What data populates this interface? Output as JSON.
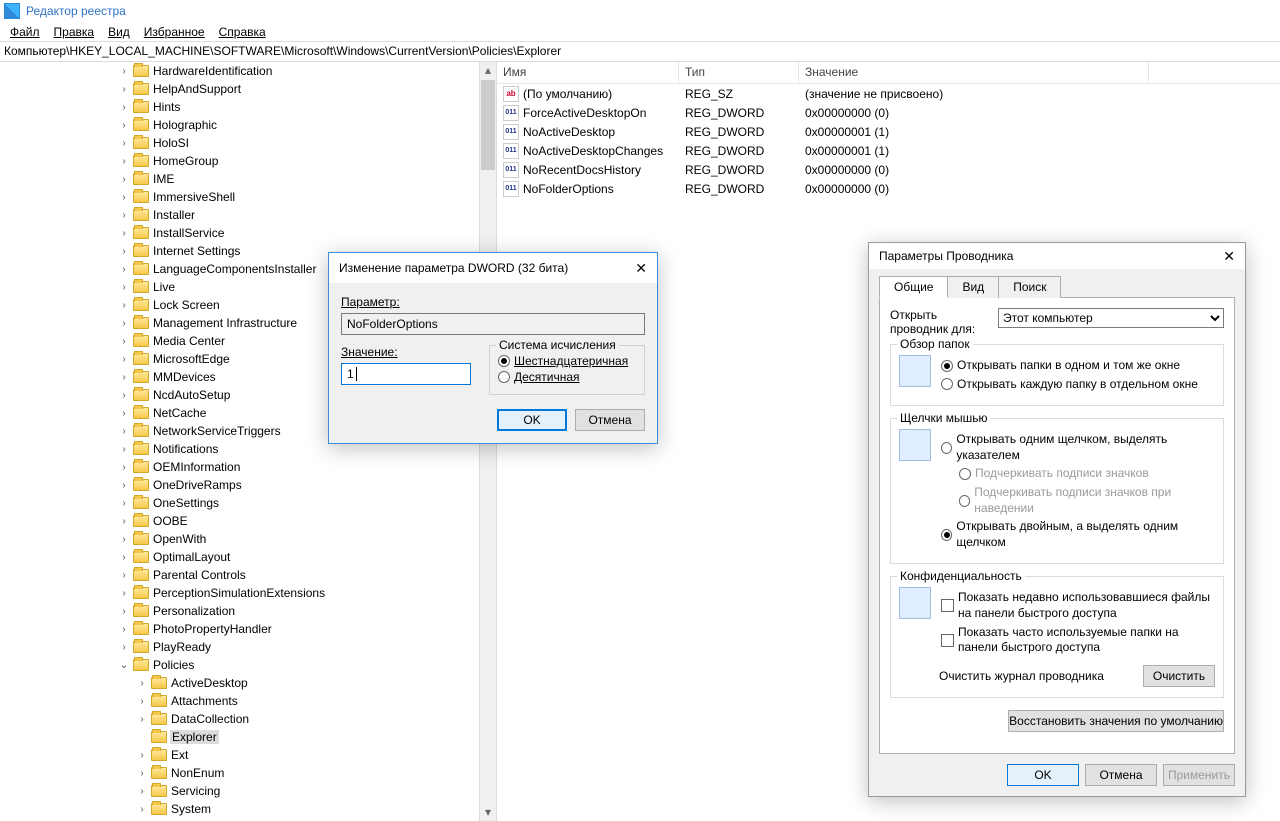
{
  "titlebar": {
    "title": "Редактор реестра"
  },
  "menu": [
    "Файл",
    "Правка",
    "Вид",
    "Избранное",
    "Справка"
  ],
  "path": "Компьютер\\HKEY_LOCAL_MACHINE\\SOFTWARE\\Microsoft\\Windows\\CurrentVersion\\Policies\\Explorer",
  "tree": {
    "items1": [
      "HardwareIdentification",
      "HelpAndSupport",
      "Hints",
      "Holographic",
      "HoloSI",
      "HomeGroup",
      "IME",
      "ImmersiveShell",
      "Installer",
      "InstallService",
      "Internet Settings",
      "LanguageComponentsInstaller",
      "Live",
      "Lock Screen",
      "Management Infrastructure",
      "Media Center",
      "MicrosoftEdge",
      "MMDevices",
      "NcdAutoSetup",
      "NetCache",
      "NetworkServiceTriggers",
      "Notifications",
      "OEMInformation",
      "OneDriveRamps",
      "OneSettings",
      "OOBE",
      "OpenWith",
      "OptimalLayout",
      "Parental Controls",
      "PerceptionSimulationExtensions",
      "Personalization",
      "PhotoPropertyHandler",
      "PlayReady"
    ],
    "policies": "Policies",
    "items2": [
      "ActiveDesktop",
      "Attachments",
      "DataCollection"
    ],
    "selected": "Explorer",
    "items3": [
      "Ext",
      "NonEnum",
      "Servicing",
      "System"
    ]
  },
  "list": {
    "cols": {
      "name": "Имя",
      "type": "Тип",
      "value": "Значение"
    },
    "rows": [
      {
        "icon": "str",
        "name": "(По умолчанию)",
        "type": "REG_SZ",
        "value": "(значение не присвоено)"
      },
      {
        "icon": "bin",
        "name": "ForceActiveDesktopOn",
        "type": "REG_DWORD",
        "value": "0x00000000 (0)"
      },
      {
        "icon": "bin",
        "name": "NoActiveDesktop",
        "type": "REG_DWORD",
        "value": "0x00000001 (1)"
      },
      {
        "icon": "bin",
        "name": "NoActiveDesktopChanges",
        "type": "REG_DWORD",
        "value": "0x00000001 (1)"
      },
      {
        "icon": "bin",
        "name": "NoRecentDocsHistory",
        "type": "REG_DWORD",
        "value": "0x00000000 (0)"
      },
      {
        "icon": "bin",
        "name": "NoFolderOptions",
        "type": "REG_DWORD",
        "value": "0x00000000 (0)"
      }
    ]
  },
  "dword": {
    "title": "Изменение параметра DWORD (32 бита)",
    "param_label": "Параметр:",
    "param_value": "NoFolderOptions",
    "value_label": "Значение:",
    "value": "1",
    "base_legend": "Система исчисления",
    "hex": "Шестнадцатеричная",
    "dec": "Десятичная",
    "ok": "OK",
    "cancel": "Отмена"
  },
  "folderopts": {
    "title": "Параметры Проводника",
    "tabs": [
      "Общие",
      "Вид",
      "Поиск"
    ],
    "open_label": "Открыть проводник для:",
    "open_value": "Этот компьютер",
    "group_browse": {
      "legend": "Обзор папок",
      "r1": "Открывать папки в одном и том же окне",
      "r2": "Открывать каждую папку в отдельном окне"
    },
    "group_click": {
      "legend": "Щелчки мышью",
      "r1": "Открывать одним щелчком, выделять указателем",
      "r1a": "Подчеркивать подписи значков",
      "r1b": "Подчеркивать подписи значков при наведении",
      "r2": "Открывать двойным, а выделять одним щелчком"
    },
    "group_privacy": {
      "legend": "Конфиденциальность",
      "c1": "Показать недавно использовавшиеся файлы на панели быстрого доступа",
      "c2": "Показать часто используемые папки на панели быстрого доступа",
      "clear_label": "Очистить журнал проводника",
      "clear_btn": "Очистить"
    },
    "restore": "Восстановить значения по умолчанию",
    "ok": "OK",
    "cancel": "Отмена",
    "apply": "Применить"
  }
}
